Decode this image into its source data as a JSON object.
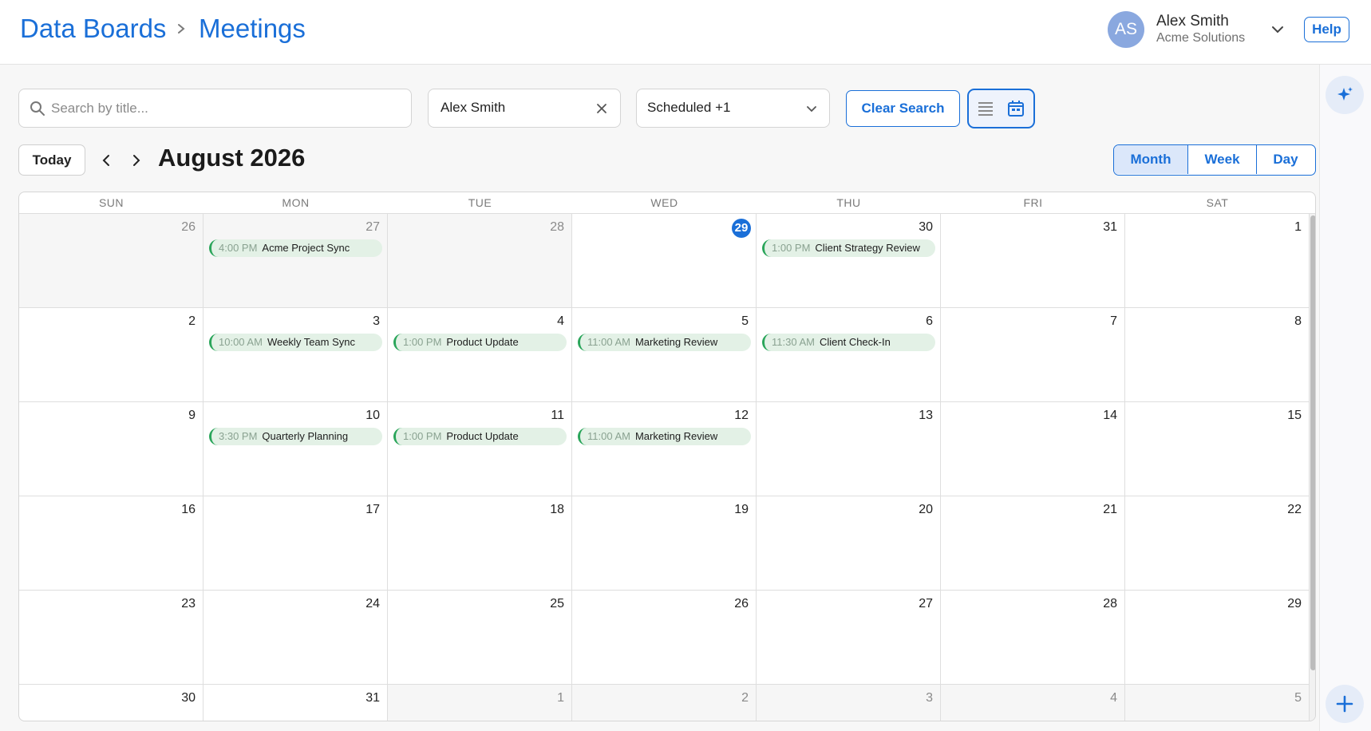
{
  "breadcrumb": {
    "root": "Data Boards",
    "current": "Meetings"
  },
  "user": {
    "initials": "AS",
    "name": "Alex Smith",
    "org": "Acme Solutions",
    "help_label": "Help"
  },
  "filters": {
    "search_placeholder": "Search by title...",
    "owner": "Alex Smith",
    "status": "Scheduled +1",
    "clear_label": "Clear Search"
  },
  "nav": {
    "today_label": "Today",
    "month_title": "August 2026",
    "view_options": [
      "Month",
      "Week",
      "Day"
    ],
    "active_view": "Month"
  },
  "calendar": {
    "weekdays": [
      "SUN",
      "MON",
      "TUE",
      "WED",
      "THU",
      "FRI",
      "SAT"
    ],
    "today": 29,
    "weeks": [
      [
        {
          "num": "26",
          "other": true
        },
        {
          "num": "27",
          "other": true,
          "events": [
            {
              "time": "4:00 PM",
              "title": "Acme Project Sync"
            }
          ]
        },
        {
          "num": "28",
          "other": true
        },
        {
          "num": "29",
          "today": true
        },
        {
          "num": "30",
          "events": [
            {
              "time": "1:00 PM",
              "title": "Client Strategy Review"
            }
          ]
        },
        {
          "num": "31"
        },
        {
          "num": "1"
        }
      ],
      [
        {
          "num": "2"
        },
        {
          "num": "3",
          "events": [
            {
              "time": "10:00 AM",
              "title": "Weekly Team Sync"
            }
          ]
        },
        {
          "num": "4",
          "events": [
            {
              "time": "1:00 PM",
              "title": "Product Update"
            }
          ]
        },
        {
          "num": "5",
          "events": [
            {
              "time": "11:00 AM",
              "title": "Marketing Review"
            }
          ]
        },
        {
          "num": "6",
          "events": [
            {
              "time": "11:30 AM",
              "title": "Client Check-In"
            }
          ]
        },
        {
          "num": "7"
        },
        {
          "num": "8"
        }
      ],
      [
        {
          "num": "9"
        },
        {
          "num": "10",
          "events": [
            {
              "time": "3:30 PM",
              "title": "Quarterly Planning"
            }
          ]
        },
        {
          "num": "11",
          "events": [
            {
              "time": "1:00 PM",
              "title": "Product Update"
            }
          ]
        },
        {
          "num": "12",
          "events": [
            {
              "time": "11:00 AM",
              "title": "Marketing Review"
            }
          ]
        },
        {
          "num": "13"
        },
        {
          "num": "14"
        },
        {
          "num": "15"
        }
      ],
      [
        {
          "num": "16"
        },
        {
          "num": "17"
        },
        {
          "num": "18"
        },
        {
          "num": "19"
        },
        {
          "num": "20"
        },
        {
          "num": "21"
        },
        {
          "num": "22"
        }
      ],
      [
        {
          "num": "23"
        },
        {
          "num": "24"
        },
        {
          "num": "25"
        },
        {
          "num": "26"
        },
        {
          "num": "27"
        },
        {
          "num": "28"
        },
        {
          "num": "29"
        }
      ],
      [
        {
          "num": "30"
        },
        {
          "num": "31"
        },
        {
          "num": "1",
          "other": true
        },
        {
          "num": "2",
          "other": true
        },
        {
          "num": "3",
          "other": true
        },
        {
          "num": "4",
          "other": true
        },
        {
          "num": "5",
          "other": true
        }
      ]
    ]
  },
  "colors": {
    "accent": "#1a6fd8",
    "event_bg": "#e3f1e6",
    "event_bar": "#2aa55a"
  },
  "icons": {
    "ai": "sparkle-icon",
    "add": "plus-icon",
    "search": "search-icon",
    "list_view": "list-icon",
    "calendar_view": "calendar-icon"
  }
}
